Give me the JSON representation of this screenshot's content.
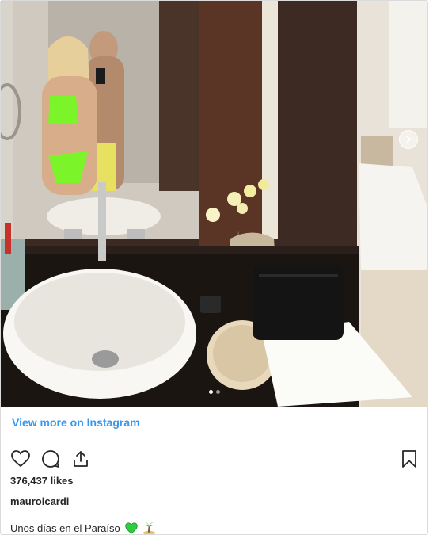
{
  "post": {
    "view_more": "View more on Instagram",
    "likes": "376,437 likes",
    "username": "mauroicardi",
    "caption": "Unos días en el Paraíso",
    "caption_emojis": [
      "green-heart-icon",
      "desert-island-icon"
    ],
    "carousel": {
      "total": 2,
      "active": 1
    }
  },
  "colors": {
    "link": "#3897f0",
    "text": "#262626",
    "border": "#dbdbdb",
    "heart_green": "#2ecc40"
  }
}
